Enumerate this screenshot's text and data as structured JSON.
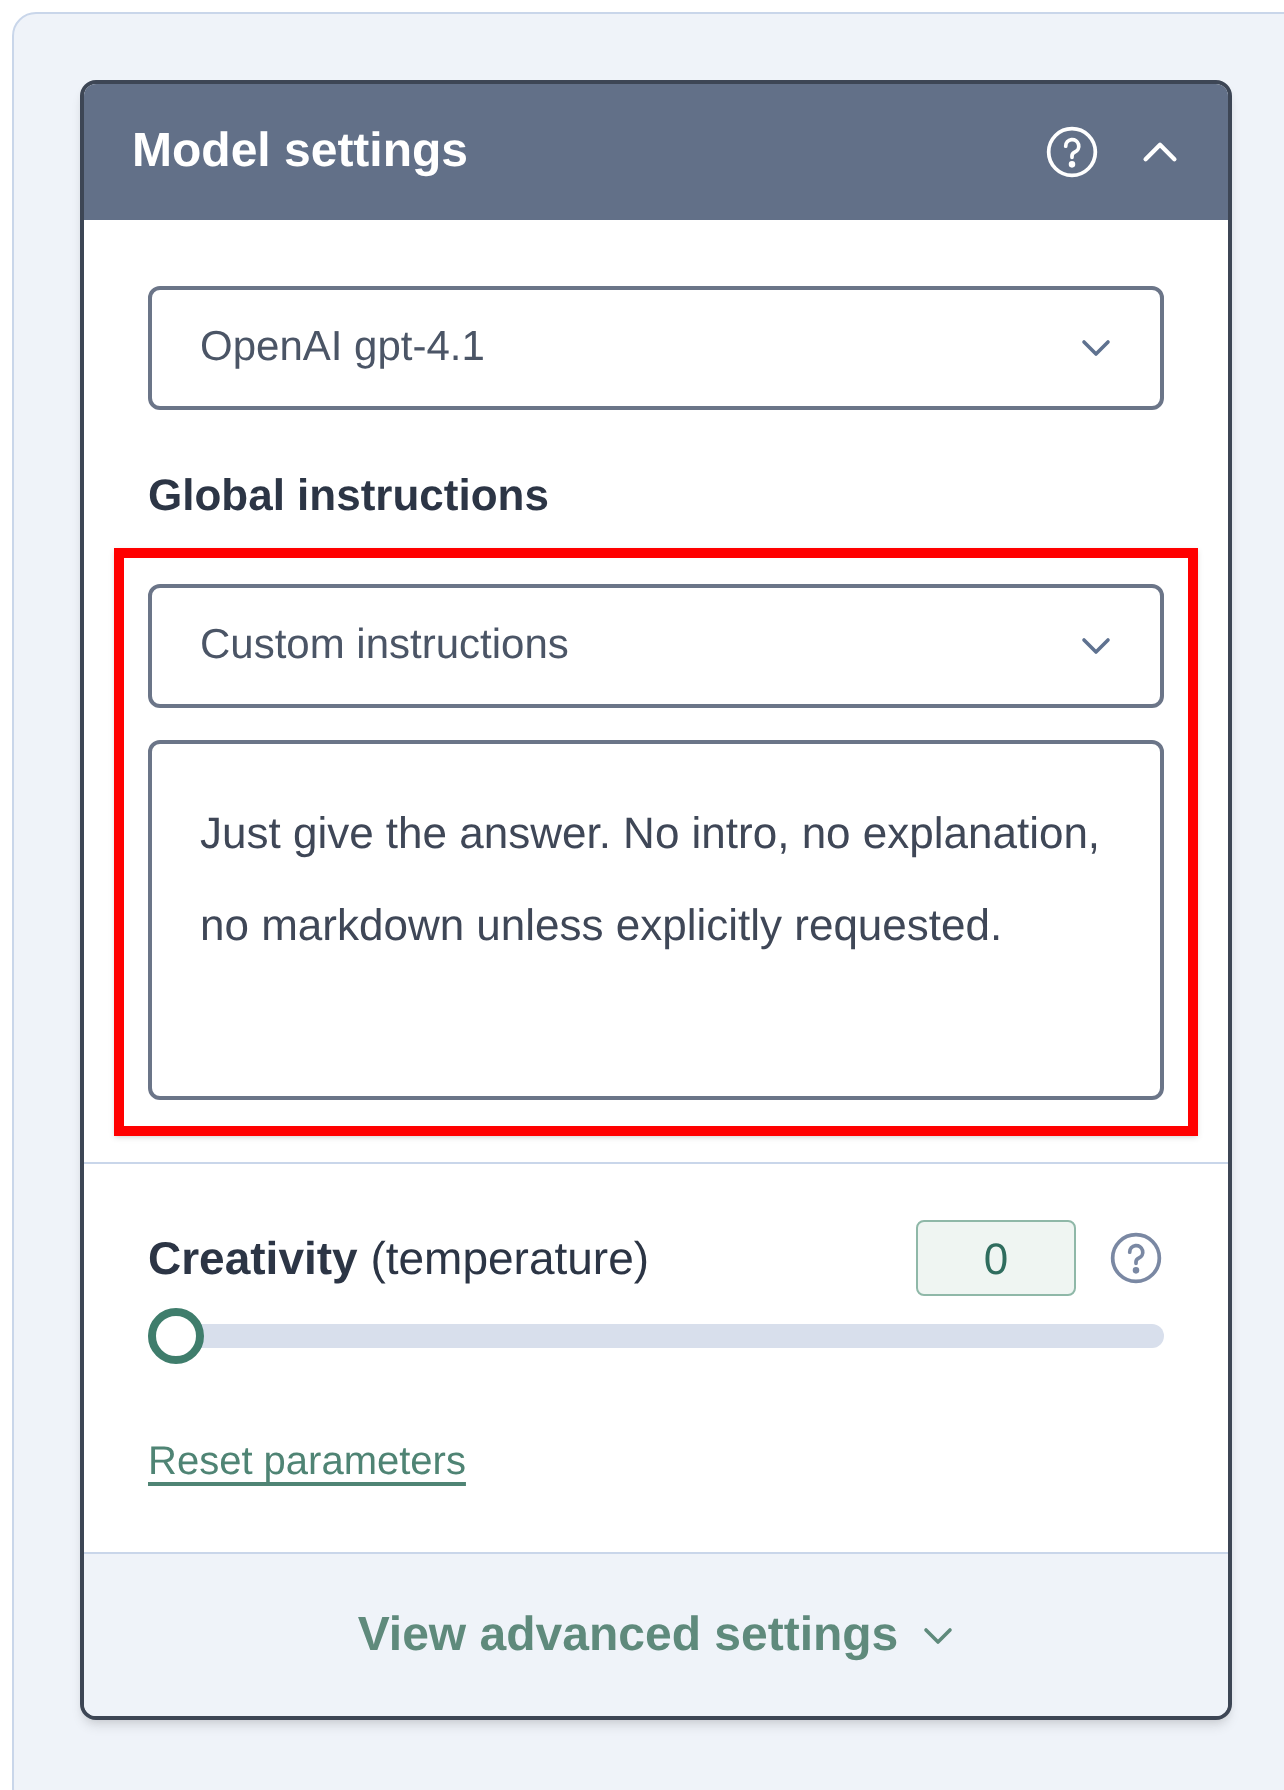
{
  "panel": {
    "title": "Model settings",
    "expanded": true
  },
  "model_select": {
    "value": "OpenAI gpt-4.1"
  },
  "global_instructions": {
    "label": "Global instructions",
    "select_value": "Custom instructions",
    "text": "Just give the answer. No intro, no explanation, no markdown unless explicitly requested.",
    "highlighted": true
  },
  "creativity": {
    "label": "**Creativity** (temperature)",
    "value": "0",
    "level": 0
  },
  "reset_link": "Reset parameters",
  "advanced": {
    "label": "View advanced settings",
    "expanded": false
  }
}
